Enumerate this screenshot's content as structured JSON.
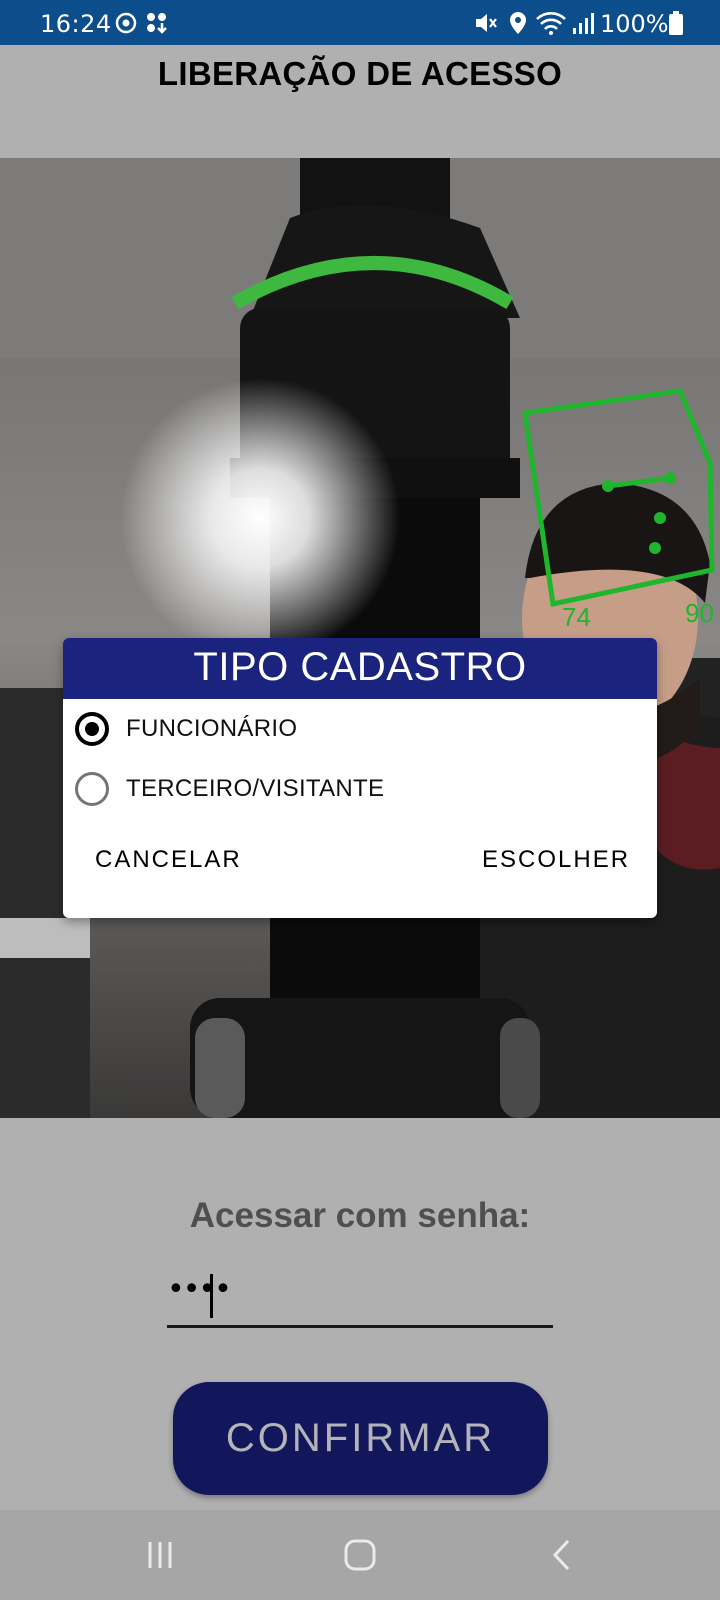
{
  "status_bar": {
    "time": "16:24",
    "battery": "100%",
    "icons": [
      "sync-icon",
      "notification-icon",
      "mute-icon",
      "location-icon",
      "wifi-icon",
      "signal-icon",
      "battery-icon"
    ]
  },
  "header": {
    "title": "LIBERAÇÃO DE ACESSO"
  },
  "camera": {
    "face_box_color": "#1fb52c",
    "labels": {
      "left": "74",
      "right": "90"
    }
  },
  "dialog": {
    "title": "TIPO CADASTRO",
    "header_color": "#1a237e",
    "options": [
      {
        "label": "FUNCIONÁRIO",
        "checked": true
      },
      {
        "label": "TERCEIRO/VISITANTE",
        "checked": false
      }
    ],
    "cancel_label": "CANCELAR",
    "choose_label": "ESCOLHER"
  },
  "login": {
    "label": "Acessar com senha:",
    "password_mask": "••••",
    "confirm_label": "CONFIRMAR",
    "button_color": "#12175c"
  },
  "nav_bar": {
    "icons": [
      "recents-icon",
      "home-icon",
      "back-icon"
    ]
  }
}
